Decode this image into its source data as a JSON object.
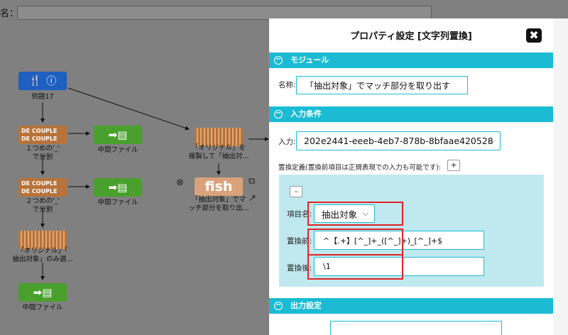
{
  "background": {
    "top_label": "名：",
    "nodes": [
      {
        "icon": "knife-fork-info-icon",
        "caption": "例題17"
      },
      {
        "icon": "decouple-icon",
        "caption": "１つめの'_'\nで分割"
      },
      {
        "icon": "intermediate-file-icon",
        "caption": "中間ファイル"
      },
      {
        "icon": "decouple-icon",
        "caption": "２つめの'_'\nで分割"
      },
      {
        "icon": "intermediate-file-icon",
        "caption": "中間ファイル"
      },
      {
        "icon": "column-select-icon",
        "caption": "「オリジナル」「\n抽出対象」のみ選..."
      },
      {
        "icon": "intermediate-file-icon",
        "caption": "中間ファイル"
      },
      {
        "icon": "column-select-icon",
        "caption": "「オリジナル」を\n複製して「抽出対..."
      },
      {
        "icon": "meat-fish-icon",
        "caption": "「抽出対象」でマ\nッチ部分を取り出..."
      }
    ],
    "decouple_text": "DE COUPLE",
    "meat_text": "meat",
    "fish_text": "fish"
  },
  "dialog": {
    "title": "プロパティ設定 [文字列置換]",
    "close_label": "✖",
    "section_module": "モジュール",
    "name_label": "名称:",
    "name_value": "「抽出対象」でマッチ部分を取り出す",
    "section_input": "入力条件",
    "input_label": "入力:",
    "input_value": "202e2441-eeeb-4eb7-878b-8bfaae420528",
    "replace_def_label": "置換定義(置換前項目は正規表現での入力も可能です):",
    "add_button": "+",
    "remove_button": "-",
    "item_name_label": "項目名:",
    "item_name_value": "抽出対象",
    "before_label": "置換前:",
    "before_value": "^【.+】[^_]+_([^_]+)_[^_]+$",
    "after_label": "置換後:",
    "after_value": "\\1",
    "section_output": "出力設定"
  },
  "colors": {
    "section": "#1bbcd3",
    "highlight": "#e02424",
    "overlay": "#808080"
  }
}
